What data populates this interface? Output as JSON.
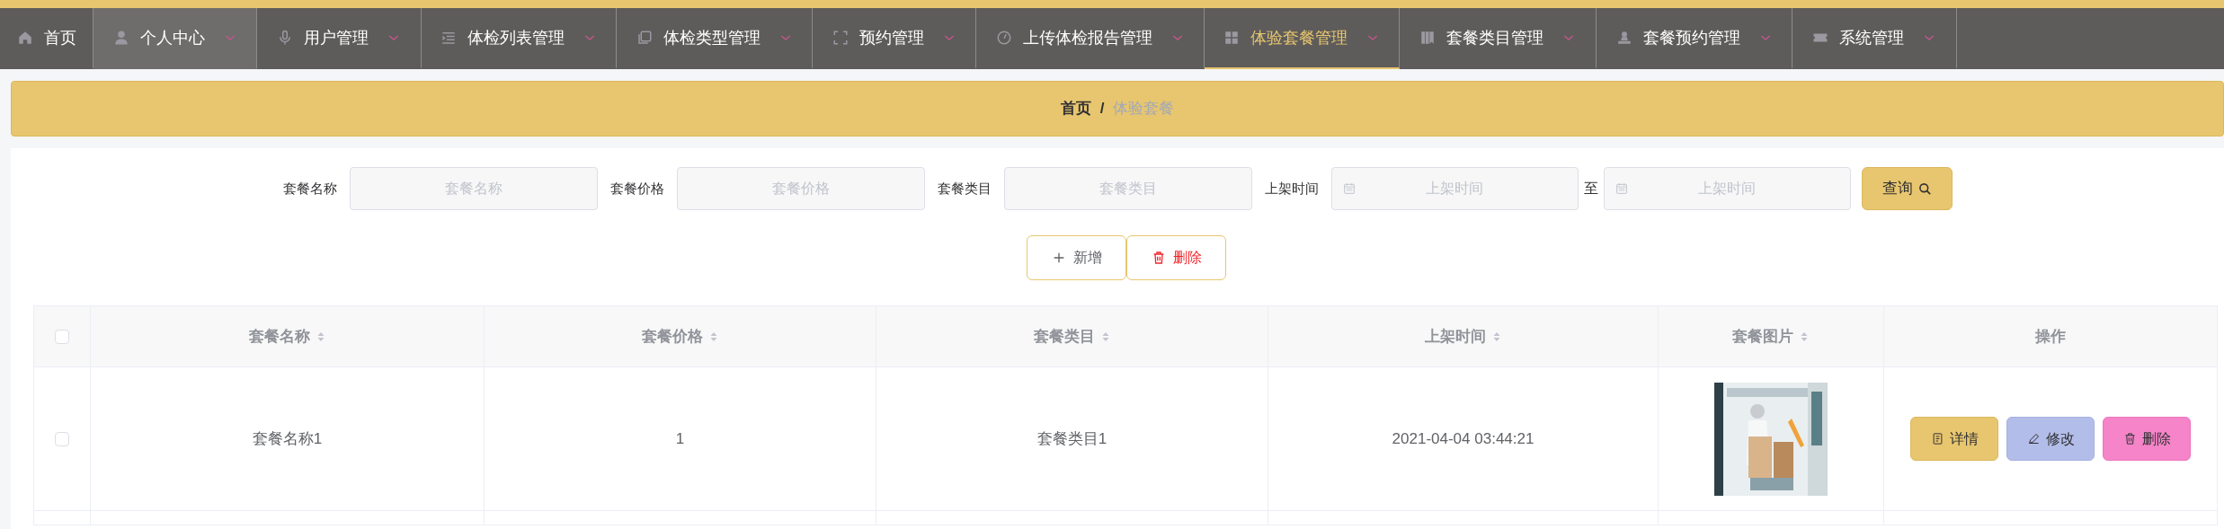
{
  "top_nav": {
    "items": [
      {
        "label": "首页",
        "has_menu": false,
        "selected": false,
        "hovered": false
      },
      {
        "label": "个人中心",
        "has_menu": true,
        "selected": false,
        "hovered": true
      },
      {
        "label": "用户管理",
        "has_menu": true,
        "selected": false,
        "hovered": false
      },
      {
        "label": "体检列表管理",
        "has_menu": true,
        "selected": false,
        "hovered": false
      },
      {
        "label": "体检类型管理",
        "has_menu": true,
        "selected": false,
        "hovered": false
      },
      {
        "label": "预约管理",
        "has_menu": true,
        "selected": false,
        "hovered": false
      },
      {
        "label": "上传体检报告管理",
        "has_menu": true,
        "selected": false,
        "hovered": false
      },
      {
        "label": "体验套餐管理",
        "has_menu": true,
        "selected": true,
        "hovered": false
      },
      {
        "label": "套餐类目管理",
        "has_menu": true,
        "selected": false,
        "hovered": false
      },
      {
        "label": "套餐预约管理",
        "has_menu": true,
        "selected": false,
        "hovered": false
      },
      {
        "label": "系统管理",
        "has_menu": true,
        "selected": false,
        "hovered": false
      }
    ]
  },
  "breadcrumb": {
    "items": [
      "首页",
      "体验套餐"
    ],
    "separator": "/"
  },
  "search": {
    "fields": [
      {
        "kind": "text",
        "label": "套餐名称",
        "placeholder": "套餐名称"
      },
      {
        "kind": "text",
        "label": "套餐价格",
        "placeholder": "套餐价格"
      },
      {
        "kind": "text",
        "label": "套餐类目",
        "placeholder": "套餐类目"
      },
      {
        "kind": "date_range",
        "label": "上架时间",
        "placeholder": "上架时间",
        "to_label": "至",
        "placeholder_to": "上架时间"
      }
    ],
    "button": "查询"
  },
  "actions": [
    {
      "kind": "add",
      "label": "新增"
    },
    {
      "kind": "delete",
      "label": "删除"
    }
  ],
  "table": {
    "select_all_checked": false,
    "columns": [
      {
        "label": "套餐名称",
        "sortable": true
      },
      {
        "label": "套餐价格",
        "sortable": true
      },
      {
        "label": "套餐类目",
        "sortable": true
      },
      {
        "label": "上架时间",
        "sortable": true
      },
      {
        "label": "套餐图片",
        "sortable": true
      },
      {
        "label": "操作",
        "sortable": false
      }
    ],
    "rows": [
      {
        "checked": false,
        "cells": [
          "套餐名称1",
          "1",
          "套餐类目1",
          "2021-04-04 03:44:21"
        ],
        "picture": {
          "kind": "picture"
        },
        "actions": [
          {
            "kind": "detail",
            "label": "详情"
          },
          {
            "kind": "edit",
            "label": "修改"
          },
          {
            "kind": "delete",
            "label": "删除"
          }
        ]
      }
    ]
  }
}
